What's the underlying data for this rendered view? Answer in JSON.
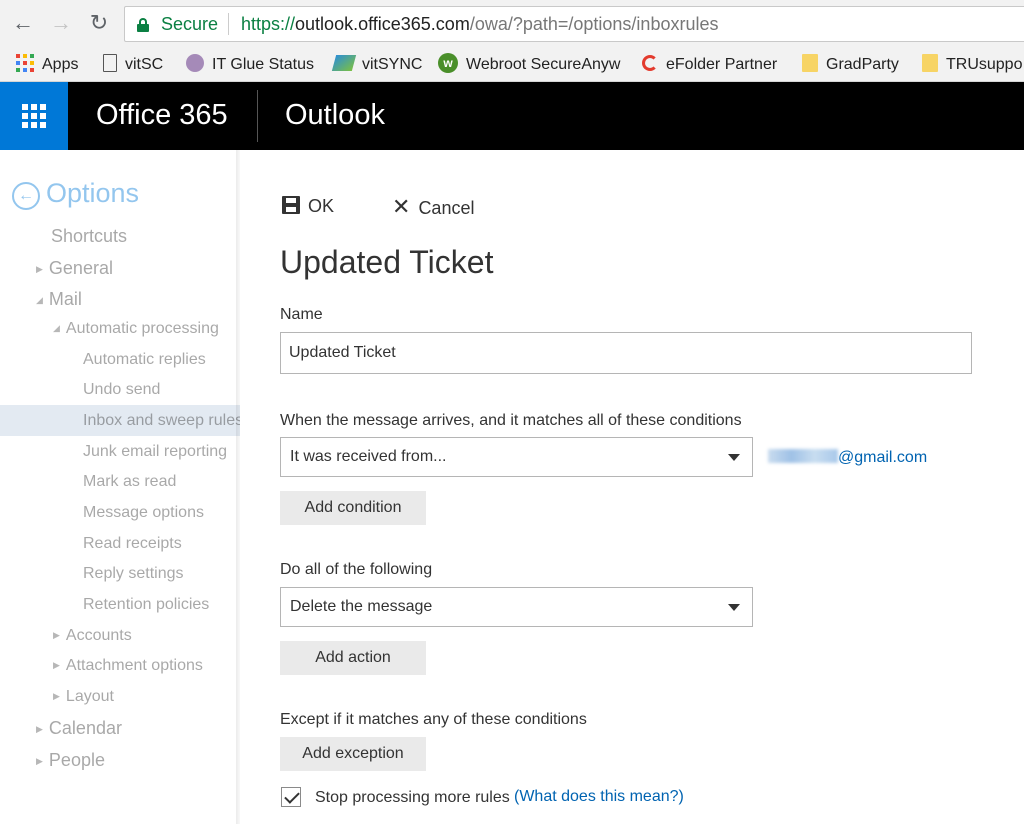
{
  "browser": {
    "secure_label": "Secure",
    "url_protocol": "https://",
    "url_host": "outlook.office365.com",
    "url_path": "/owa/?path=/options/inboxrules",
    "bookmarks": [
      {
        "label": "Apps",
        "icon": "apps-grid-icon"
      },
      {
        "label": "vitSC",
        "icon": "page-icon"
      },
      {
        "label": "IT Glue Status",
        "icon": "it-glue-icon"
      },
      {
        "label": "vitSYNC",
        "icon": "vitsync-icon"
      },
      {
        "label": "Webroot SecureAnyw",
        "icon": "webroot-icon"
      },
      {
        "label": "eFolder Partner",
        "icon": "efolder-icon"
      },
      {
        "label": "GradParty",
        "icon": "folder-icon"
      },
      {
        "label": "TRUsuppo",
        "icon": "folder-icon"
      }
    ]
  },
  "header": {
    "brand": "Office 365",
    "app_name": "Outlook",
    "accent": "#0078d7"
  },
  "nav": {
    "title": "Options",
    "shortcuts": "Shortcuts",
    "general": "General",
    "mail": "Mail",
    "automatic_processing": "Automatic processing",
    "auto_items": [
      "Automatic replies",
      "Undo send",
      "Inbox and sweep rules",
      "Junk email reporting",
      "Mark as read",
      "Message options",
      "Read receipts",
      "Reply settings",
      "Retention policies"
    ],
    "accounts": "Accounts",
    "attachment_options": "Attachment options",
    "layout": "Layout",
    "calendar": "Calendar",
    "people": "People"
  },
  "form": {
    "ok_label": "OK",
    "cancel_label": "Cancel",
    "title": "Updated Ticket",
    "name_label": "Name",
    "name_value": "Updated Ticket",
    "conditions_label": "When the message arrives, and it matches all of these conditions",
    "condition_value": "It was received from...",
    "condition_email_domain": "@gmail.com",
    "add_condition": "Add condition",
    "actions_label": "Do all of the following",
    "action_value": "Delete the message",
    "add_action": "Add action",
    "exceptions_label": "Except if it matches any of these conditions",
    "add_exception": "Add exception",
    "stop_processing": "Stop processing more rules",
    "help_link": "(What does this mean?)",
    "stop_processing_checked": true
  }
}
